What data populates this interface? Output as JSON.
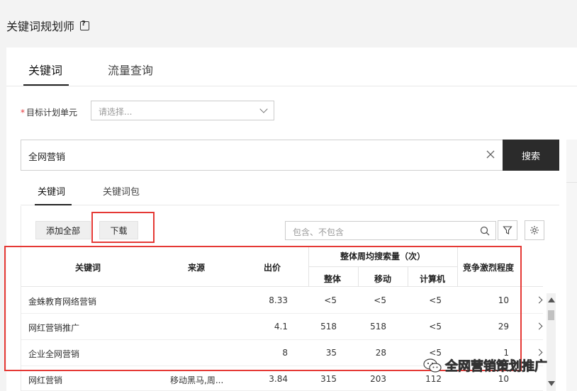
{
  "page_title": "关键词规划师",
  "main_tabs": [
    {
      "label": "关键词"
    },
    {
      "label": "流量查询"
    }
  ],
  "unit": {
    "required_mark": "*",
    "label": "目标计划单元",
    "placeholder": "请选择..."
  },
  "search": {
    "value": "全网营销",
    "button_label": "搜索"
  },
  "sub_tabs": [
    {
      "label": "关键词"
    },
    {
      "label": "关键词包"
    }
  ],
  "toolbar": {
    "add_all_label": "添加全部",
    "download_label": "下载",
    "filter_placeholder": "包含、不包含"
  },
  "table": {
    "headers": {
      "keyword": "关键词",
      "source": "来源",
      "bid": "出价",
      "weekly_search_group": "整体周均搜索量（次）",
      "overall": "整体",
      "mobile": "移动",
      "computer": "计算机",
      "competition": "竞争激烈程度"
    },
    "rows": [
      {
        "keyword": "金蛛教育网络营销",
        "source": "",
        "bid": "8.33",
        "overall": "<5",
        "mobile": "<5",
        "computer": "<5",
        "competition": "10"
      },
      {
        "keyword": "网红营销推广",
        "source": "",
        "bid": "4.1",
        "overall": "518",
        "mobile": "518",
        "computer": "<5",
        "competition": "29"
      },
      {
        "keyword": "企业全网营销",
        "source": "",
        "bid": "8",
        "overall": "35",
        "mobile": "28",
        "computer": "<5",
        "competition": "1"
      },
      {
        "keyword": "网红营销",
        "source": "移动黑马,周...",
        "bid": "3.84",
        "overall": "315",
        "mobile": "203",
        "computer": "112",
        "competition": "10"
      }
    ]
  },
  "watermark": {
    "text": "全网营销策划推广",
    "icon": "wechat-icon"
  },
  "colors": {
    "highlight_box": "#e53935",
    "search_button": "#2b2b2b",
    "required": "#e4393c"
  }
}
